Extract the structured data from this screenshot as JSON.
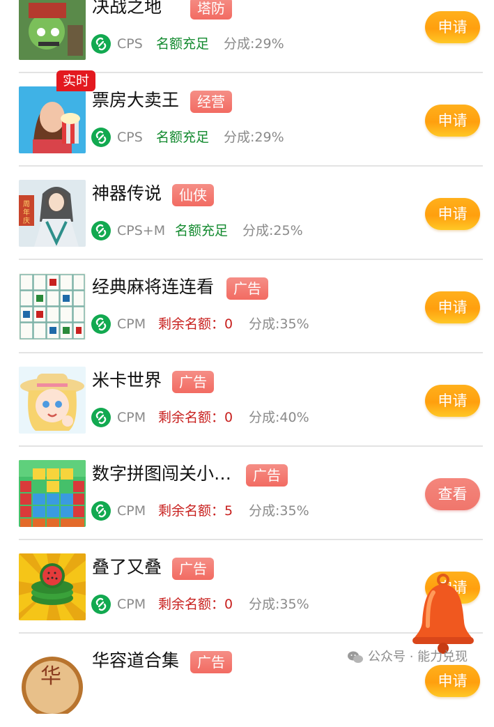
{
  "colors": {
    "apply_button": "#ffa815",
    "view_button": "#f27a70",
    "tag": "#f37a70",
    "realtime_badge": "#e3191f",
    "link_icon": "#12a950",
    "quota_green": "#138a2f",
    "quota_red": "#c8211f"
  },
  "items": [
    {
      "title": "决战之地",
      "tag": "塔防",
      "type": "CPS",
      "quota": "名额充足",
      "share": "分成:29%",
      "button": "申请",
      "badge": "实时"
    },
    {
      "title": "票房大卖王",
      "tag": "经营",
      "type": "CPS",
      "quota": "名额充足",
      "share": "分成:29%",
      "button": "申请",
      "badge": "实时"
    },
    {
      "title": "神器传说",
      "tag": "仙侠",
      "type": "CPS+M",
      "quota": "名额充足",
      "share": "分成:25%",
      "button": "申请",
      "badge": ""
    },
    {
      "title": "经典麻将连连看",
      "tag": "广告",
      "type": "CPM",
      "quota": "剩余名额：0",
      "share": "分成:35%",
      "button": "申请",
      "badge": ""
    },
    {
      "title": "米卡世界",
      "tag": "广告",
      "type": "CPM",
      "quota": "剩余名额：0",
      "share": "分成:40%",
      "button": "申请",
      "badge": ""
    },
    {
      "title": "数字拼图闯关小…",
      "tag": "广告",
      "type": "CPM",
      "quota": "剩余名额：5",
      "share": "分成:35%",
      "button": "查看",
      "badge": ""
    },
    {
      "title": "叠了又叠",
      "tag": "广告",
      "type": "CPM",
      "quota": "剩余名额：0",
      "share": "分成:35%",
      "button": "申请",
      "badge": ""
    },
    {
      "title": "华容道合集",
      "tag": "广告",
      "type": "",
      "quota": "",
      "share": "",
      "button": "申请",
      "badge": ""
    }
  ],
  "thumbnail_texts": {
    "item3_badge": "周年庆",
    "item8_logo": "华"
  },
  "watermark": {
    "text": "公众号 · 能力兑现"
  }
}
